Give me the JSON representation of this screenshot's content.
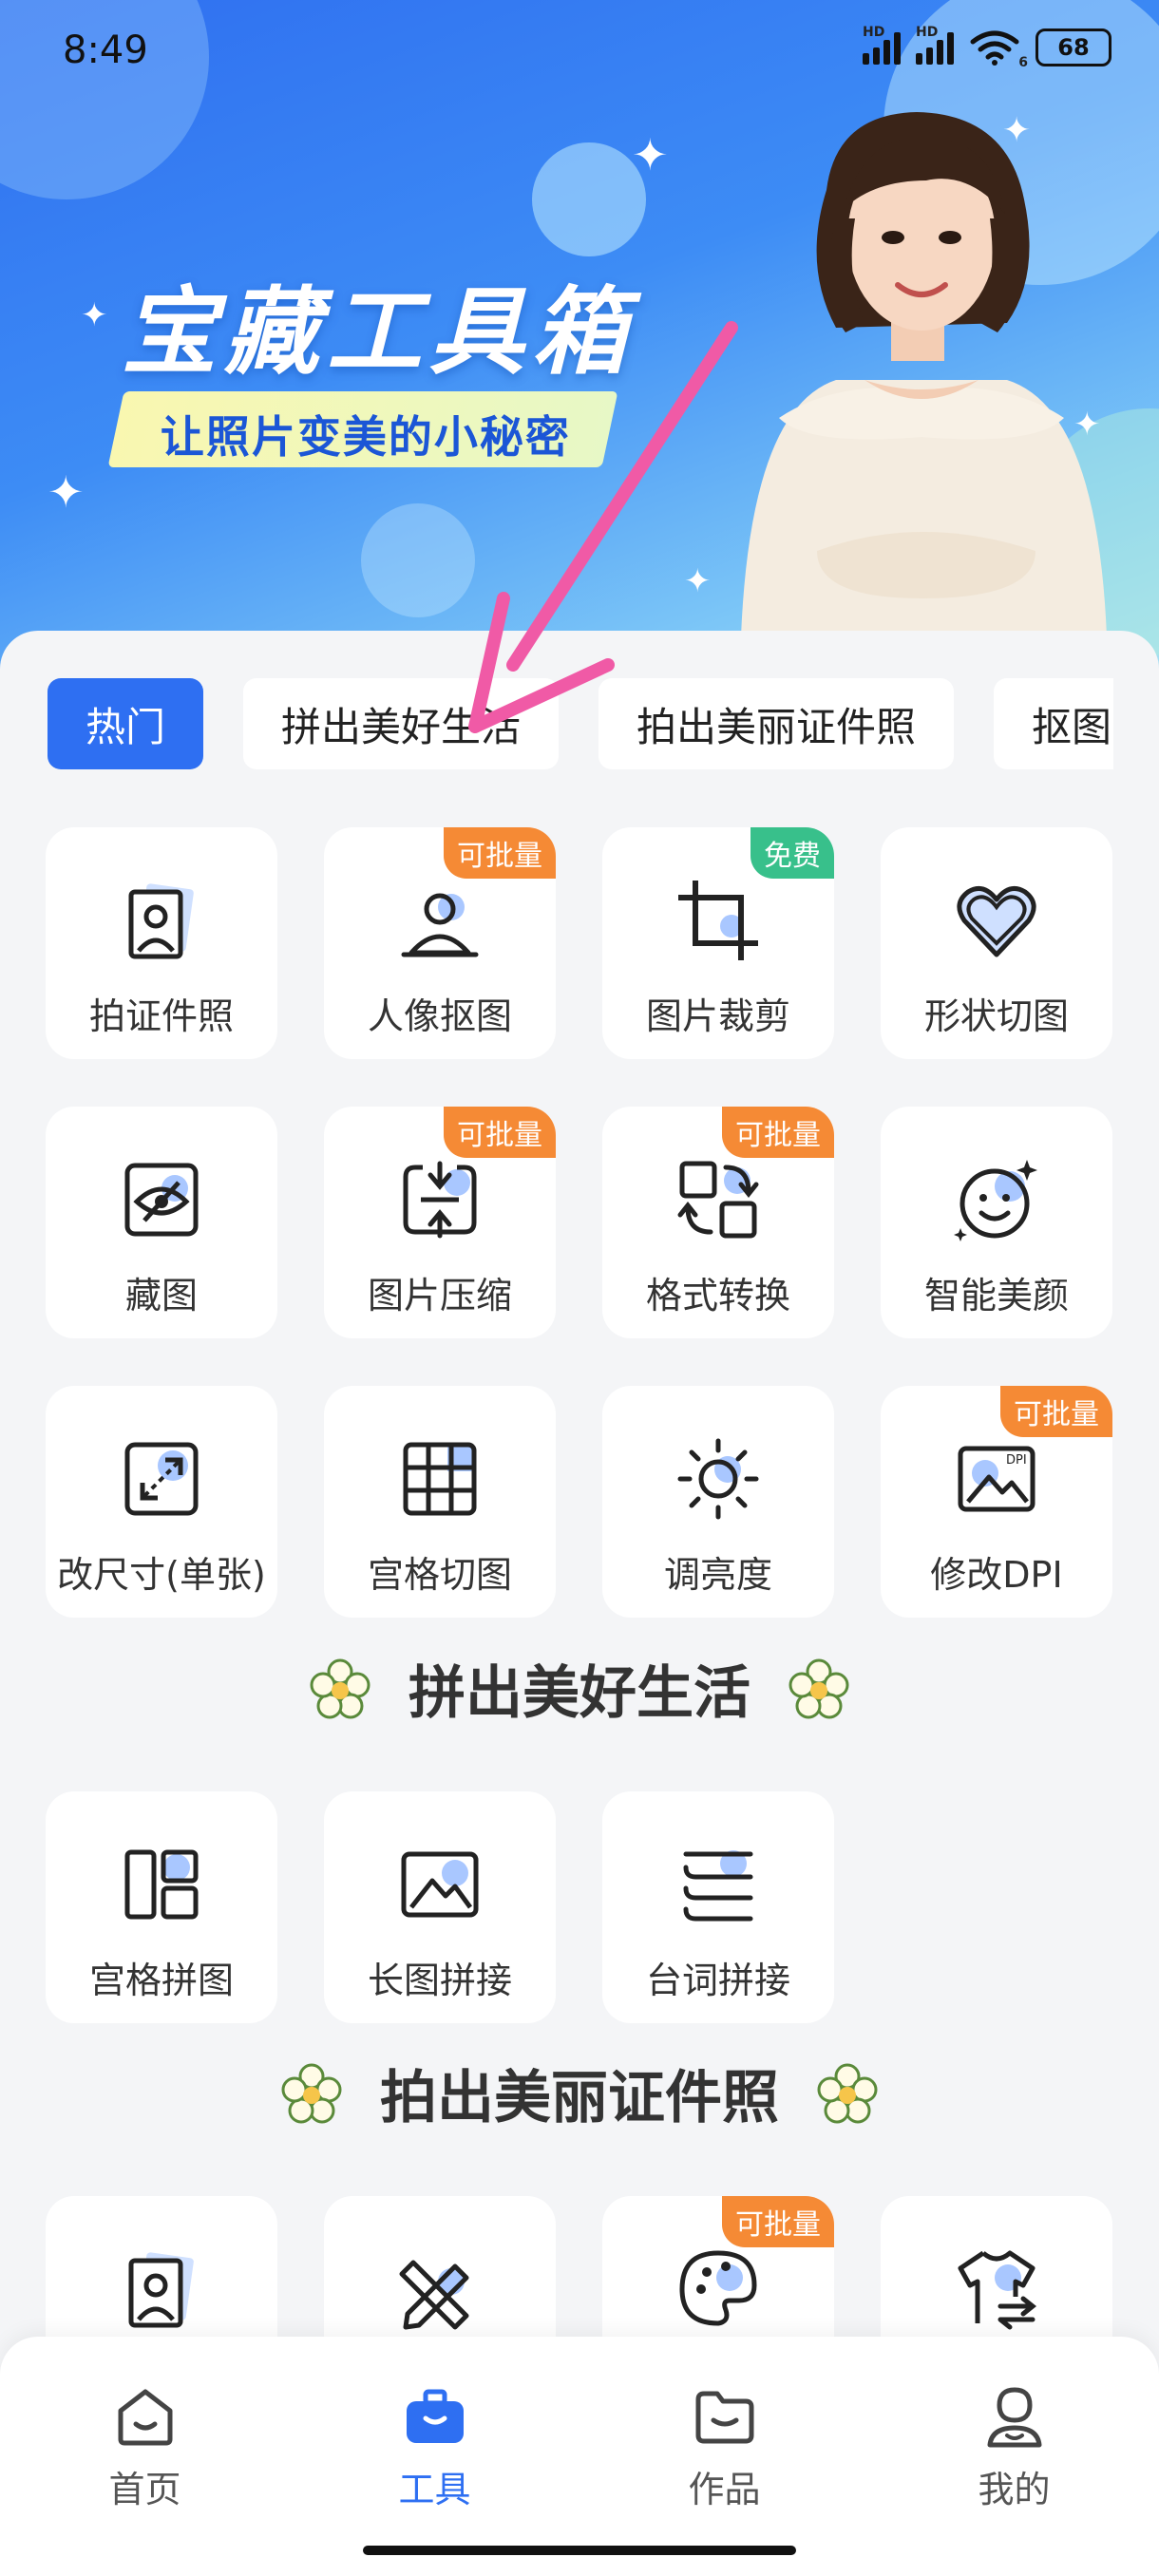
{
  "status_bar": {
    "time": "8:49",
    "network_1": "HD",
    "network_2": "HD",
    "wifi_label": "6",
    "battery": "68"
  },
  "banner": {
    "title": "宝藏工具箱",
    "subtitle": "让照片变美的小秘密"
  },
  "tabs": [
    {
      "label": "热门",
      "active": true
    },
    {
      "label": "拼出美好生活",
      "active": false
    },
    {
      "label": "拍出美丽证件照",
      "active": false
    },
    {
      "label": "抠图",
      "active": false
    }
  ],
  "hot_tools": [
    {
      "label": "拍证件照",
      "icon": "id-photo-icon",
      "badge": ""
    },
    {
      "label": "人像抠图",
      "icon": "portrait-cutout-icon",
      "badge": "可批量"
    },
    {
      "label": "图片裁剪",
      "icon": "crop-icon",
      "badge": "免费"
    },
    {
      "label": "形状切图",
      "icon": "heart-shape-icon",
      "badge": ""
    },
    {
      "label": "藏图",
      "icon": "hide-image-icon",
      "badge": ""
    },
    {
      "label": "图片压缩",
      "icon": "compress-icon",
      "badge": "可批量"
    },
    {
      "label": "格式转换",
      "icon": "format-convert-icon",
      "badge": "可批量"
    },
    {
      "label": "智能美颜",
      "icon": "beauty-face-icon",
      "badge": ""
    },
    {
      "label": "改尺寸(单张)",
      "icon": "resize-icon",
      "badge": ""
    },
    {
      "label": "宫格切图",
      "icon": "grid-cut-icon",
      "badge": ""
    },
    {
      "label": "调亮度",
      "icon": "brightness-icon",
      "badge": ""
    },
    {
      "label": "修改DPI",
      "icon": "dpi-icon",
      "badge": "可批量"
    }
  ],
  "section_collage": {
    "title": "拼出美好生活",
    "tools": [
      {
        "label": "宫格拼图",
        "icon": "grid-collage-icon"
      },
      {
        "label": "长图拼接",
        "icon": "long-image-icon"
      },
      {
        "label": "台词拼接",
        "icon": "subtitle-stitch-icon"
      }
    ]
  },
  "section_id_photo": {
    "title": "拍出美丽证件照",
    "tools": [
      {
        "icon": "id-photo-icon",
        "badge": ""
      },
      {
        "icon": "edit-tools-icon",
        "badge": ""
      },
      {
        "icon": "palette-icon",
        "badge": "可批量"
      },
      {
        "icon": "clothes-change-icon",
        "badge": ""
      }
    ]
  },
  "bottom_nav": [
    {
      "label": "首页",
      "icon": "home-icon",
      "active": false
    },
    {
      "label": "工具",
      "icon": "toolbox-icon",
      "active": true
    },
    {
      "label": "作品",
      "icon": "folder-icon",
      "active": false
    },
    {
      "label": "我的",
      "icon": "profile-icon",
      "active": false
    }
  ],
  "colors": {
    "accent": "#2e6ff2",
    "badge_orange": "#f58a35",
    "badge_green": "#38c08b",
    "annotation_arrow": "#f05aa6"
  }
}
